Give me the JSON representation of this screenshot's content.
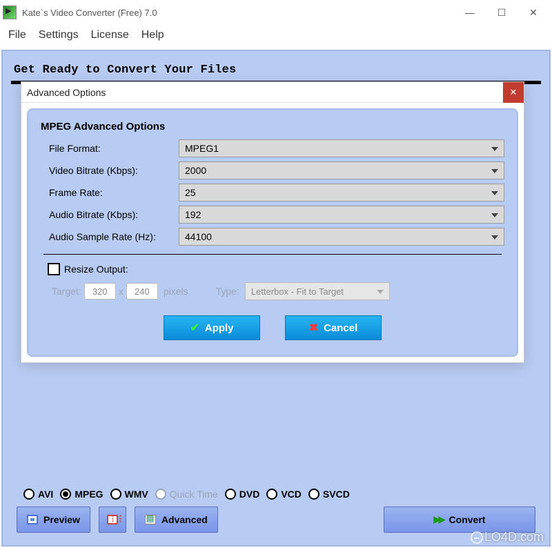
{
  "window": {
    "title": "Kate`s Video Converter (Free) 7.0"
  },
  "menu": {
    "file": "File",
    "settings": "Settings",
    "license": "License",
    "help": "Help"
  },
  "main": {
    "heading": "Get Ready to Convert Your Files"
  },
  "dialog": {
    "title": "Advanced Options",
    "section_title": "MPEG Advanced Options",
    "rows": {
      "file_format": {
        "label": "File Format:",
        "value": "MPEG1"
      },
      "video_bitrate": {
        "label": "Video Bitrate (Kbps):",
        "value": "2000"
      },
      "frame_rate": {
        "label": "Frame Rate:",
        "value": "25"
      },
      "audio_bitrate": {
        "label": "Audio Bitrate (Kbps):",
        "value": "192"
      },
      "audio_sample_rate": {
        "label": "Audio Sample Rate (Hz):",
        "value": "44100"
      }
    },
    "resize": {
      "label": "Resize Output:",
      "target_label": "Target:",
      "width": "320",
      "x": "x",
      "height": "240",
      "pixels": "pixels",
      "type_label": "Type:",
      "type_value": "Letterbox - Fit to Target"
    },
    "buttons": {
      "apply": "Apply",
      "cancel": "Cancel"
    }
  },
  "formats": {
    "avi": "AVI",
    "mpeg": "MPEG",
    "wmv": "WMV",
    "quicktime": "Quick Time",
    "dvd": "DVD",
    "vcd": "VCD",
    "svcd": "SVCD"
  },
  "buttons": {
    "preview": "Preview",
    "advanced": "Advanced",
    "convert": "Convert"
  },
  "watermark": "LO4D.com"
}
